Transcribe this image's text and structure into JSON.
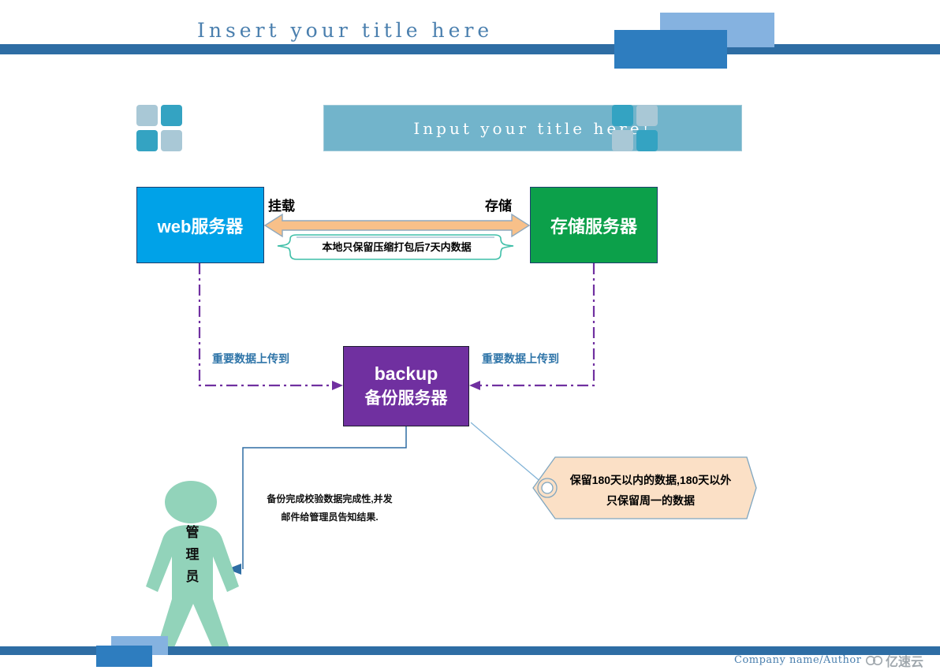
{
  "page": {
    "title": "Insert your title here",
    "banner_title": "Input your title here!"
  },
  "diagram": {
    "nodes": [
      {
        "id": "web",
        "label": "web服务器",
        "color": "#00A2E8"
      },
      {
        "id": "storage",
        "label": "存储服务器",
        "color": "#0CA04A"
      },
      {
        "id": "backup",
        "label_en": "backup",
        "label_cn": "备份服务器",
        "color": "#7030A0"
      }
    ],
    "edge_labels": {
      "mount": "挂载",
      "store": "存储",
      "upload_left": "重要数据上传到",
      "upload_right": "重要数据上传到"
    },
    "brace_note": "本地只保留压缩打包后7天内数据",
    "tag_note_line1": "保留180天以内的数据,180天以外",
    "tag_note_line2": "只保留周一的数据",
    "admin_note_line1": "备份完成校验数据完成性,并发",
    "admin_note_line2": "邮件给管理员告知结果.",
    "admin_label_chars": [
      "管",
      "理",
      "员"
    ]
  },
  "footer": {
    "company": "Company name/Author",
    "watermark": "亿速云"
  },
  "colors": {
    "bar_blue": "#2E6DA4",
    "deco_light": "#85B2E0",
    "deco_dark": "#2E7DBF",
    "banner": "#72B4CB",
    "arrow_orange": "#F8C089",
    "dash_purple": "#7030A0",
    "brace_teal": "#3FBFA8",
    "tag_peach": "#FBE0C6",
    "admin_green": "#92D3BA",
    "label_blue": "#2E74A8"
  }
}
